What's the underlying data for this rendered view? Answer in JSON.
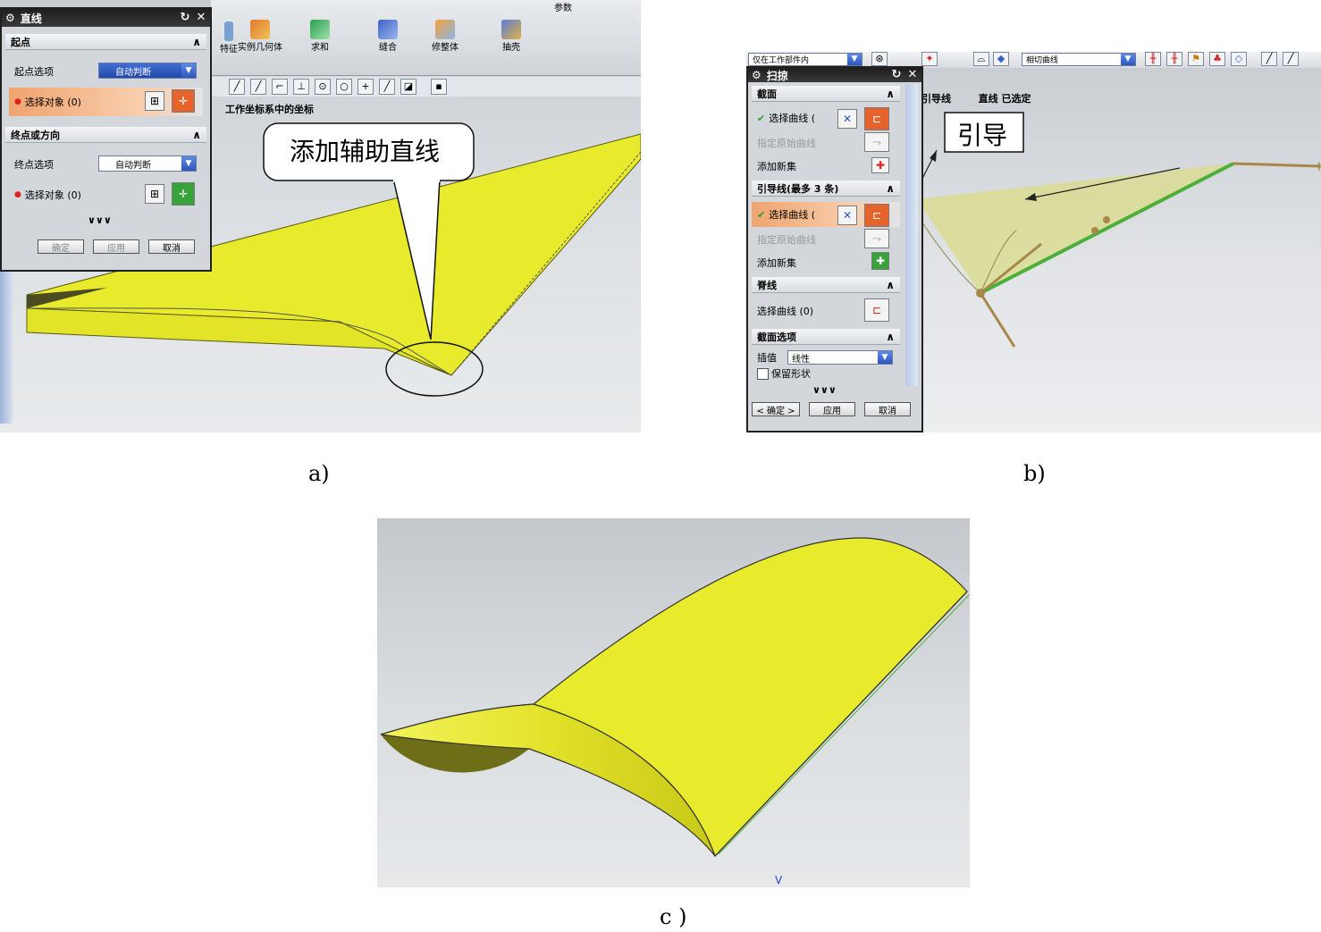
{
  "panel_a": {
    "caption": "a)",
    "dialog": {
      "title": "直线",
      "start_section": "起点",
      "start_option_label": "起点选项",
      "start_option_value": "自动判断",
      "start_select_label": "选择对象 (0)",
      "end_section": "终点或方向",
      "end_option_label": "终点选项",
      "end_option_value": "自动判断",
      "end_select_label": "选择对象 (0)",
      "more": "∨∨∨",
      "ok": "确定",
      "apply": "应用",
      "cancel": "取消"
    },
    "toolbar_items": [
      "特征",
      "实例几何体",
      "求和",
      "缝合",
      "修整体",
      "抽壳"
    ],
    "toolbar_menu": "参数",
    "coord_label": "工作坐标系中的坐标",
    "callout": "添加辅助直线"
  },
  "panel_b": {
    "caption": "b)",
    "filter_value": "仅在工作部件内",
    "curve_rule_value": "相切曲线",
    "status_text": "引导线        直线 已选定",
    "dialog": {
      "title": "扫掠",
      "section_header": "截面",
      "section_select": "选择曲线 (",
      "section_origin": "指定原始曲线",
      "section_add": "添加新集",
      "guide_header": "引导线(最多 3 条)",
      "guide_select": "选择曲线 (",
      "guide_origin": "指定原始曲线",
      "guide_add": "添加新集",
      "spine_header": "脊线",
      "spine_select": "选择曲线 (0)",
      "section_options_header": "截面选项",
      "interp_label": "插值",
      "interp_value": "线性",
      "preserve_shape": "保留形状",
      "more": "∨∨∨",
      "ok": "< 确定 >",
      "apply": "应用",
      "cancel": "取消"
    },
    "callout": "引导"
  },
  "panel_c": {
    "caption": "c )",
    "axis_label": "V"
  },
  "colors": {
    "surface_yellow": "#e8ea2c",
    "surface_shadow": "#8d8c14",
    "dialog_orange": "#e7632c",
    "check_green": "#2aa02a"
  }
}
